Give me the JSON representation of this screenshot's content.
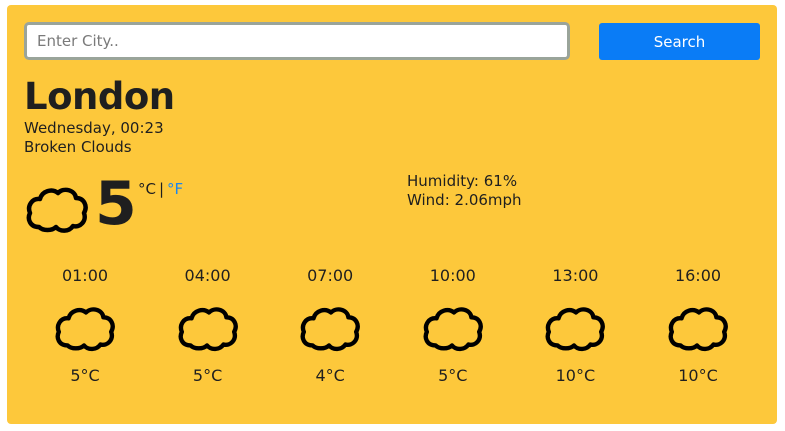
{
  "search": {
    "placeholder": "Enter City..",
    "value": "",
    "button_label": "Search"
  },
  "current": {
    "city": "London",
    "datetime": "Wednesday, 00:23",
    "condition": "Broken Clouds",
    "icon": "cloud-icon",
    "temperature": "5",
    "unit_celsius": "°C",
    "unit_separator": "|",
    "unit_fahrenheit": "°F",
    "humidity": "Humidity: 61%",
    "wind": "Wind: 2.06mph"
  },
  "forecast": [
    {
      "time": "01:00",
      "temp": "5°C",
      "icon": "cloud-icon"
    },
    {
      "time": "04:00",
      "temp": "5°C",
      "icon": "cloud-icon"
    },
    {
      "time": "07:00",
      "temp": "4°C",
      "icon": "cloud-icon"
    },
    {
      "time": "10:00",
      "temp": "5°C",
      "icon": "cloud-icon"
    },
    {
      "time": "13:00",
      "temp": "10°C",
      "icon": "cloud-icon"
    },
    {
      "time": "16:00",
      "temp": "10°C",
      "icon": "cloud-icon"
    }
  ],
  "colors": {
    "background": "#fdc83b",
    "button": "#0a7cf6",
    "link_unit": "#1a86f0",
    "text": "#1f1f1f"
  }
}
